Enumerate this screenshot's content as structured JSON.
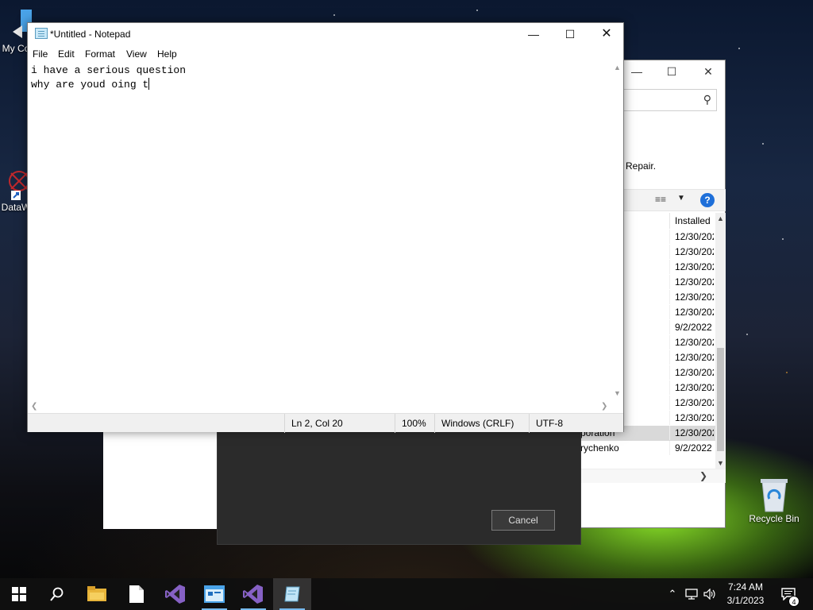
{
  "desktop": {
    "icons": [
      {
        "label": "My Co"
      },
      {
        "label": "DataW"
      },
      {
        "label": "Recycle Bin"
      }
    ]
  },
  "programs_window": {
    "repair_text": "Repair.",
    "help_label": "?",
    "column_header": "Installed",
    "rows": [
      {
        "publisher": "",
        "date": "12/30/202"
      },
      {
        "publisher": "",
        "date": "12/30/202"
      },
      {
        "publisher": "",
        "date": "12/30/202"
      },
      {
        "publisher": "",
        "date": "12/30/202"
      },
      {
        "publisher": "",
        "date": "12/30/202"
      },
      {
        "publisher": "",
        "date": "12/30/202"
      },
      {
        "publisher": "",
        "date": "9/2/2022"
      },
      {
        "publisher": "",
        "date": "12/30/202"
      },
      {
        "publisher": "",
        "date": "12/30/202"
      },
      {
        "publisher": "",
        "date": "12/30/202"
      },
      {
        "publisher": "",
        "date": "12/30/202"
      },
      {
        "publisher": "",
        "date": "12/30/202"
      },
      {
        "publisher": "",
        "date": "12/30/202"
      },
      {
        "publisher": "poration",
        "date": "12/30/202",
        "selected": true
      },
      {
        "publisher": "rychenko",
        "date": "9/2/2022"
      }
    ]
  },
  "dialog": {
    "cancel_label": "Cancel"
  },
  "notepad": {
    "title": "*Untitled - Notepad",
    "menu": [
      "File",
      "Edit",
      "Format",
      "View",
      "Help"
    ],
    "line1": "i have a serious question",
    "line2": "why are youd oing t",
    "status": {
      "position": "Ln 2, Col 20",
      "zoom": "100%",
      "line_endings": "Windows (CRLF)",
      "encoding": "UTF-8"
    }
  },
  "taskbar": {
    "items": [
      "start-icon",
      "search-icon",
      "file-explorer-icon",
      "notepad-file-icon",
      "visual-studio-icon",
      "app-window-icon",
      "visual-studio-icon-2",
      "notepad-icon"
    ],
    "clock_time": "7:24 AM",
    "clock_date": "3/1/2023",
    "notification_count": "4"
  }
}
